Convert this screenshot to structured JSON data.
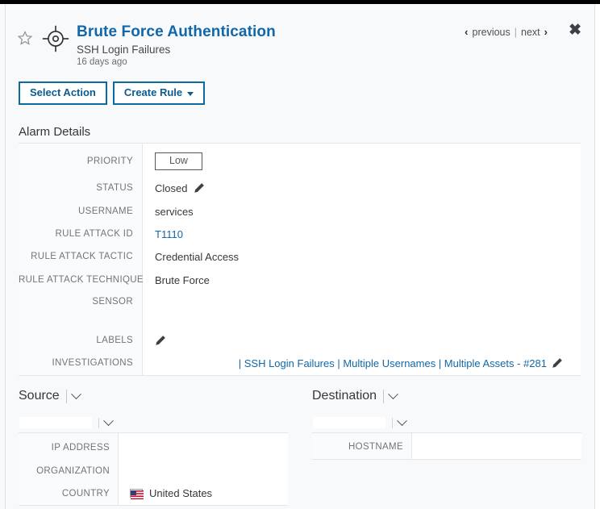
{
  "header": {
    "title": "Brute Force Authentication",
    "subtitle": "SSH Login Failures",
    "time_ago": "16 days ago",
    "star_icon": "star-outline-icon",
    "alarm_icon": "crosshair-target-icon",
    "nav": {
      "prev_arrow": "‹",
      "previous": "previous",
      "separator": "|",
      "next": "next",
      "next_arrow": "›",
      "close": "✖"
    },
    "buttons": {
      "select_action": "Select Action",
      "create_rule": "Create Rule"
    }
  },
  "alarm_details": {
    "section_title": "Alarm Details",
    "rows": [
      {
        "label": "PRIORITY",
        "value": "Low",
        "kind": "pill"
      },
      {
        "label": "STATUS",
        "value": "Closed",
        "kind": "text-edit"
      },
      {
        "label": "USERNAME",
        "value": "services",
        "kind": "text"
      },
      {
        "label": "RULE ATTACK ID",
        "value": "T1110",
        "kind": "link"
      },
      {
        "label": "RULE ATTACK TACTIC",
        "value": "Credential Access",
        "kind": "text"
      },
      {
        "label": "RULE ATTACK TECHNIQUE",
        "value": "Brute Force",
        "kind": "text"
      },
      {
        "label": "SENSOR",
        "value": "",
        "kind": "text"
      },
      {
        "label": "LABELS",
        "value": "",
        "kind": "edit-only"
      },
      {
        "label": "INVESTIGATIONS",
        "value": "| SSH Login Failures | Multiple Usernames | Multiple Assets - #281",
        "kind": "investigations"
      }
    ]
  },
  "source": {
    "heading": "Source",
    "selected": "",
    "rows": [
      {
        "label": "IP ADDRESS",
        "value": ""
      },
      {
        "label": "ORGANIZATION",
        "value": ""
      },
      {
        "label": "COUNTRY",
        "value": "United States",
        "flag": "us-flag-icon"
      }
    ]
  },
  "destination": {
    "heading": "Destination",
    "selected": "",
    "rows": [
      {
        "label": "HOSTNAME",
        "value": ""
      }
    ]
  },
  "colors": {
    "accent_blue": "#1267a8",
    "button_border": "#0b6ba0",
    "page_bg": "#f7f9fb",
    "label_text": "#70757b"
  }
}
